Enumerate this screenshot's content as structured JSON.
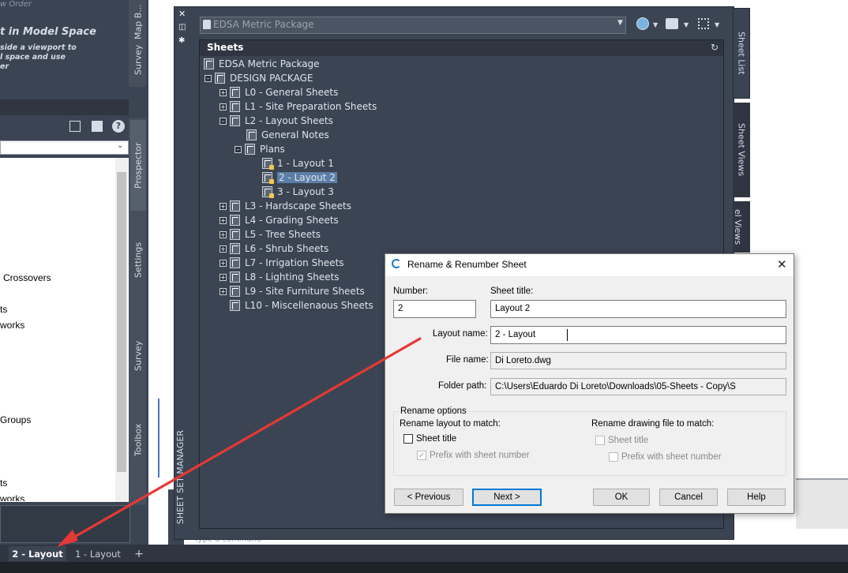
{
  "left_panel": {
    "top_fade_text": "w Order",
    "model_space_title": "t in Model Space",
    "model_space_desc": [
      "side a viewport to",
      "l space and use",
      "er"
    ],
    "list_items": [
      "Crossovers",
      "ts",
      "works",
      "Groups",
      "ts",
      "works"
    ],
    "vtabs": [
      "Map B...",
      "Survey",
      "Prospector",
      "Settings",
      "Survey",
      "Toolbox"
    ]
  },
  "palette": {
    "combo_value": "EDSA Metric Package",
    "section_title": "Sheets",
    "side_title": "SHEET SET MANAGER",
    "right_tabs": [
      "Sheet List",
      "Sheet Views",
      "el Views"
    ],
    "tree": {
      "root": "EDSA Metric Package",
      "package": "DESIGN PACKAGE",
      "items": [
        "L0 - General Sheets",
        "L1 - Site Preparation Sheets",
        "L2 - Layout Sheets",
        "General Notes",
        "Plans",
        "1 - Layout 1",
        "2 - Layout 2",
        "3 - Layout 3",
        "L3 - Hardscape Sheets",
        "L4 - Grading Sheets",
        "L5 - Tree Sheets",
        "L6 - Shrub Sheets",
        "L7 - Irrigation Sheets",
        "L8 - Lighting Sheets",
        "L9 - Site Furniture Sheets",
        "L10 - Miscellenaous Sheets"
      ]
    }
  },
  "dialog": {
    "title": "Rename & Renumber Sheet",
    "number_label": "Number:",
    "number_value": "2",
    "title_label": "Sheet title:",
    "title_value": "Layout 2",
    "layout_label": "Layout name:",
    "layout_value": "2 - Layout",
    "file_label": "File name:",
    "file_value": "Di Loreto.dwg",
    "folder_label": "Folder path:",
    "folder_value": "C:\\Users\\Eduardo Di Loreto\\Downloads\\05-Sheets - Copy\\S",
    "options_label": "Rename options",
    "rename_layout_label": "Rename layout to match:",
    "rename_drawing_label": "Rename drawing file to match:",
    "opt_sheet_title": "Sheet title",
    "opt_prefix": "Prefix with sheet number",
    "buttons": {
      "previous": "< Previous",
      "next": "Next >",
      "ok": "OK",
      "cancel": "Cancel",
      "help": "Help"
    }
  },
  "bottom": {
    "command_text": "Type a command",
    "tabs": [
      "2 - Layout",
      "1 - Layout"
    ]
  },
  "colors": {
    "panel": "#3b4453",
    "arrow": "#e53935",
    "selection": "#5d7ea8",
    "taskbar": "#1e2329"
  }
}
